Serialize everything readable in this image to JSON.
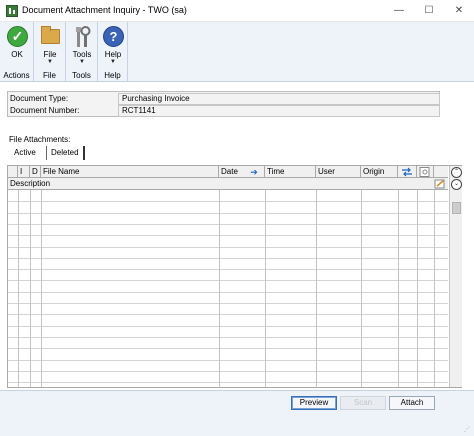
{
  "window": {
    "title": "Document Attachment Inquiry  -  TWO (sa)",
    "controls": {
      "minimize": "—",
      "maximize": "☐",
      "close": "✕"
    }
  },
  "ribbon": {
    "groups": [
      {
        "label": "Actions",
        "buttons": [
          {
            "label": "OK",
            "icon": "ok-check-icon"
          }
        ]
      },
      {
        "label": "File",
        "buttons": [
          {
            "label": "File",
            "icon": "folder-icon",
            "dropdown": true
          }
        ]
      },
      {
        "label": "Tools",
        "buttons": [
          {
            "label": "Tools",
            "icon": "tools-icon",
            "dropdown": true
          }
        ]
      },
      {
        "label": "Help",
        "buttons": [
          {
            "label": "Help",
            "icon": "help-icon",
            "dropdown": true
          }
        ]
      }
    ]
  },
  "header": {
    "document_type_label": "Document Type:",
    "document_type_value": "Purchasing Invoice",
    "document_number_label": "Document Number:",
    "document_number_value": "RCT1141"
  },
  "attachments": {
    "section_label": "File Attachments:",
    "tabs": [
      {
        "label": "Active",
        "selected": true
      },
      {
        "label": "Deleted",
        "selected": false
      }
    ],
    "columns": [
      "I",
      "D",
      "File Name",
      "Date",
      "Time",
      "User",
      "Origin"
    ],
    "second_row_label": "Description",
    "rows": []
  },
  "buttons": {
    "preview": "Preview",
    "scan": "Scan",
    "attach": "Attach"
  },
  "colors": {
    "ribbon_bg": "#eef3fa",
    "ok_green": "#3fa83f",
    "help_blue": "#3a62b5",
    "folder": "#d9a94a"
  }
}
